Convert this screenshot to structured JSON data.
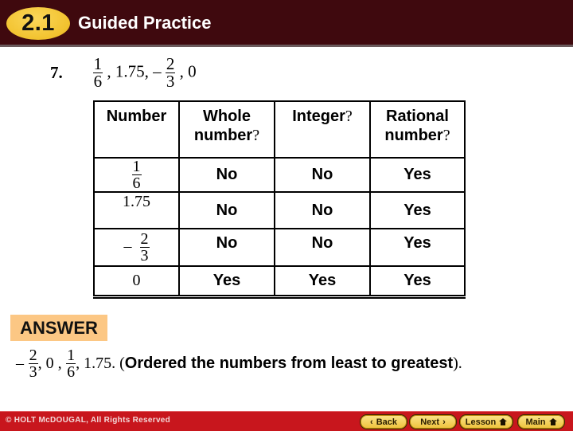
{
  "header": {
    "badge": "2.1",
    "title": "Guided Practice",
    "colors": {
      "bar": "#3f090e",
      "badge": "#f2c22e"
    }
  },
  "problem": {
    "label": "7.",
    "sequence": [
      {
        "type": "frac",
        "sign": "",
        "num": "1",
        "den": "6"
      },
      {
        "type": "text",
        "value": ", 1.75, –"
      },
      {
        "type": "frac",
        "sign": "",
        "num": "2",
        "den": "3"
      },
      {
        "type": "text",
        "value": ", 0"
      }
    ]
  },
  "table": {
    "headers": [
      {
        "text": "Number",
        "q": ""
      },
      {
        "text": "Whole number",
        "q": "?"
      },
      {
        "text": "Integer",
        "q": "?"
      },
      {
        "text": "Rational number",
        "q": "?"
      }
    ],
    "rows": [
      {
        "number": {
          "sign": "",
          "num": "1",
          "den": "6"
        },
        "whole": "No",
        "integer": "No",
        "rational": "Yes"
      },
      {
        "number": {
          "text": "1.75"
        },
        "whole": "No",
        "integer": "No",
        "rational": "Yes"
      },
      {
        "number": {
          "sign": "–",
          "num": "2",
          "den": "3"
        },
        "whole": "No",
        "integer": "No",
        "rational": "Yes"
      },
      {
        "number": {
          "text": "0"
        },
        "whole": "Yes",
        "integer": "Yes",
        "rational": "Yes"
      }
    ]
  },
  "answer": {
    "label": "ANSWER",
    "sign": "–",
    "frac1": {
      "num": "2",
      "den": "3"
    },
    "mid": ", 0 ,",
    "frac2": {
      "num": "1",
      "den": "6"
    },
    "tail": ", 1.75. (",
    "explanation": "Ordered the numbers from least to greatest",
    "end": ").",
    "colors": {
      "label_bg": "#fcc784"
    }
  },
  "footer": {
    "copyright": "© HOLT McDOUGAL, All Rights Reserved",
    "buttons": {
      "back": "Back",
      "next": "Next",
      "lesson": "Lesson",
      "main": "Main"
    },
    "colors": {
      "bar": "#c8161d",
      "button": "#eec23a"
    }
  }
}
